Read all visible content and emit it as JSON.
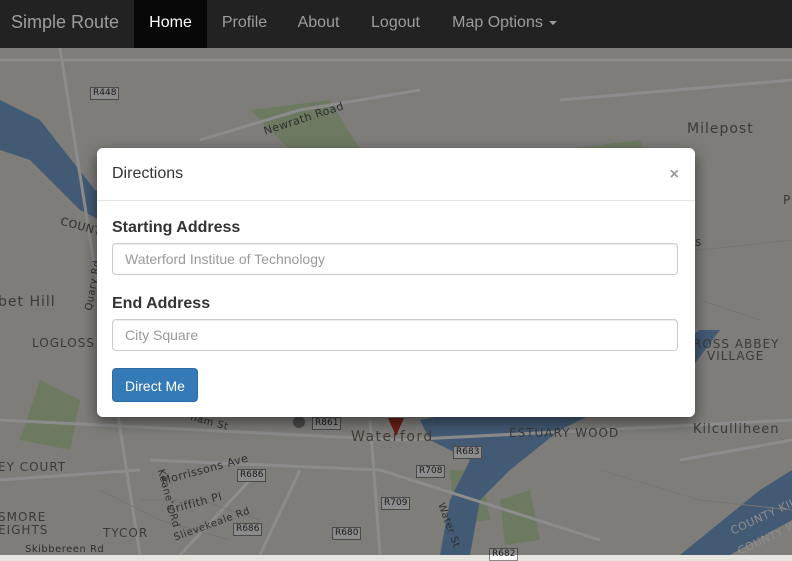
{
  "navbar": {
    "brand": "Simple Route",
    "items": [
      {
        "label": "Home",
        "active": true
      },
      {
        "label": "Profile"
      },
      {
        "label": "About"
      },
      {
        "label": "Logout"
      },
      {
        "label": "Map Options",
        "dropdown": true
      }
    ]
  },
  "modal": {
    "title": "Directions",
    "close": "×",
    "start_label": "Starting Address",
    "start_placeholder": "Waterford Institue of Technology",
    "end_label": "End Address",
    "end_placeholder": "City Square",
    "submit_label": "Direct Me"
  },
  "map": {
    "labels": {
      "newrath": "Newrath Road",
      "milepost": "Milepost",
      "bet_hill": "bet Hill",
      "logloss": "LOGLOSS",
      "cross_abbey": "ROSS ABBEY",
      "village": "VILLAGE",
      "count": "COUNT",
      "quary": "Quary Rd",
      "waterford": "Waterford",
      "estuary": "ESTUARY WOOD",
      "kilcullheen": "Kilculliheen",
      "ey_court": "EY COURT",
      "morrissons": "Morrissons Ave",
      "keanes": "Keane's Rd",
      "griffith": "Griffith Pl",
      "smore": "SMORE",
      "eights": "EIGHTS",
      "tycor": "TYCOR",
      "slievekeale": "Slievekeale Rd",
      "skibbereen": "Skibbereen Rd",
      "nam_st": "nam St",
      "water_st": "Water St",
      "county_kil": "COUNTY KIL",
      "county_wa": "COUNTY WA",
      "p_edge": "P",
      "s_edge": "s"
    },
    "roads": {
      "r448": "R448",
      "r861": "R861",
      "r683": "R683",
      "r708": "R708",
      "r686a": "R686",
      "r686b": "R686",
      "r709": "R709",
      "r680": "R680",
      "r682": "R682"
    },
    "colors": {
      "water": "#7ba5d6",
      "land": "#e6e4df",
      "park": "#c6dfb1",
      "road": "#ffffff",
      "pin": "#c0392b"
    }
  }
}
